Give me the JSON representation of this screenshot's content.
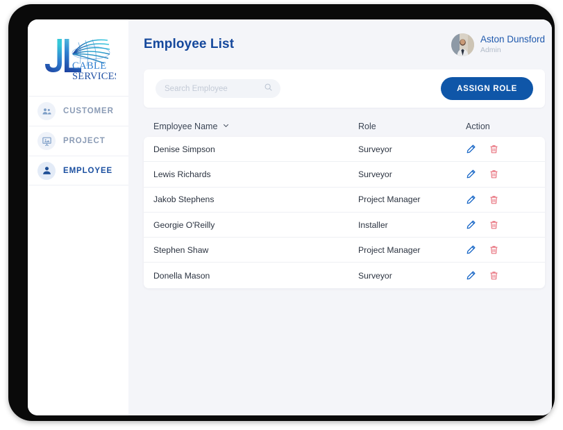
{
  "app": {
    "brand": {
      "initials": "JL",
      "line1": "CABLE",
      "line2": "SERVICES"
    }
  },
  "sidebar": {
    "items": [
      {
        "label": "CUSTOMER",
        "icon": "people-group-icon",
        "active": false
      },
      {
        "label": "PROJECT",
        "icon": "presentation-board-icon",
        "active": false
      },
      {
        "label": "EMPLOYEE",
        "icon": "person-icon",
        "active": true
      }
    ]
  },
  "header": {
    "title": "Employee List",
    "user": {
      "name": "Aston Dunsford",
      "role": "Admin",
      "avatar_icon": "user-photo-avatar"
    }
  },
  "toolbar": {
    "search": {
      "placeholder": "Search Employee",
      "value": "",
      "icon": "search-icon"
    },
    "assign_role_label": "ASSIGN ROLE"
  },
  "table": {
    "columns": {
      "name": "Employee Name",
      "role": "Role",
      "action": "Action"
    },
    "sort_icon": "chevron-down-icon",
    "row_actions": {
      "edit_icon": "pencil-edit-icon",
      "delete_icon": "trash-delete-icon"
    },
    "rows": [
      {
        "name": "Denise Simpson",
        "role": "Surveyor"
      },
      {
        "name": "Lewis Richards",
        "role": "Surveyor"
      },
      {
        "name": "Jakob Stephens",
        "role": "Project Manager"
      },
      {
        "name": "Georgie O'Reilly",
        "role": "Installer"
      },
      {
        "name": "Stephen Shaw",
        "role": "Project Manager"
      },
      {
        "name": "Donella Mason",
        "role": "Surveyor"
      }
    ]
  },
  "colors": {
    "brand_blue": "#0f56a8",
    "title_blue": "#15489c",
    "edit_blue": "#1766c6",
    "delete_red": "#e8737f",
    "page_bg": "#f4f5f9"
  }
}
